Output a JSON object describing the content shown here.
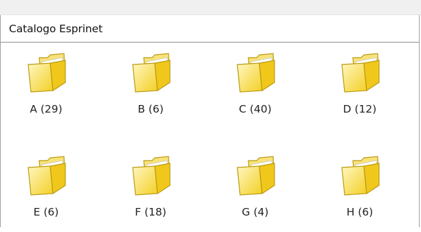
{
  "catalog": {
    "title": "Catalogo Esprinet"
  },
  "folders": [
    {
      "label": "A (29)",
      "icon": "folder-icon"
    },
    {
      "label": "B (6)",
      "icon": "folder-icon"
    },
    {
      "label": "C (40)",
      "icon": "folder-icon"
    },
    {
      "label": "D (12)",
      "icon": "folder-icon"
    },
    {
      "label": "E (6)",
      "icon": "folder-icon"
    },
    {
      "label": "F (18)",
      "icon": "folder-icon"
    },
    {
      "label": "G (4)",
      "icon": "folder-icon"
    },
    {
      "label": "H (6)",
      "icon": "folder-icon"
    }
  ],
  "colors": {
    "folder_fill": "#f6dc4e",
    "folder_light": "#fdf4b8",
    "folder_stroke": "#b99a10"
  }
}
